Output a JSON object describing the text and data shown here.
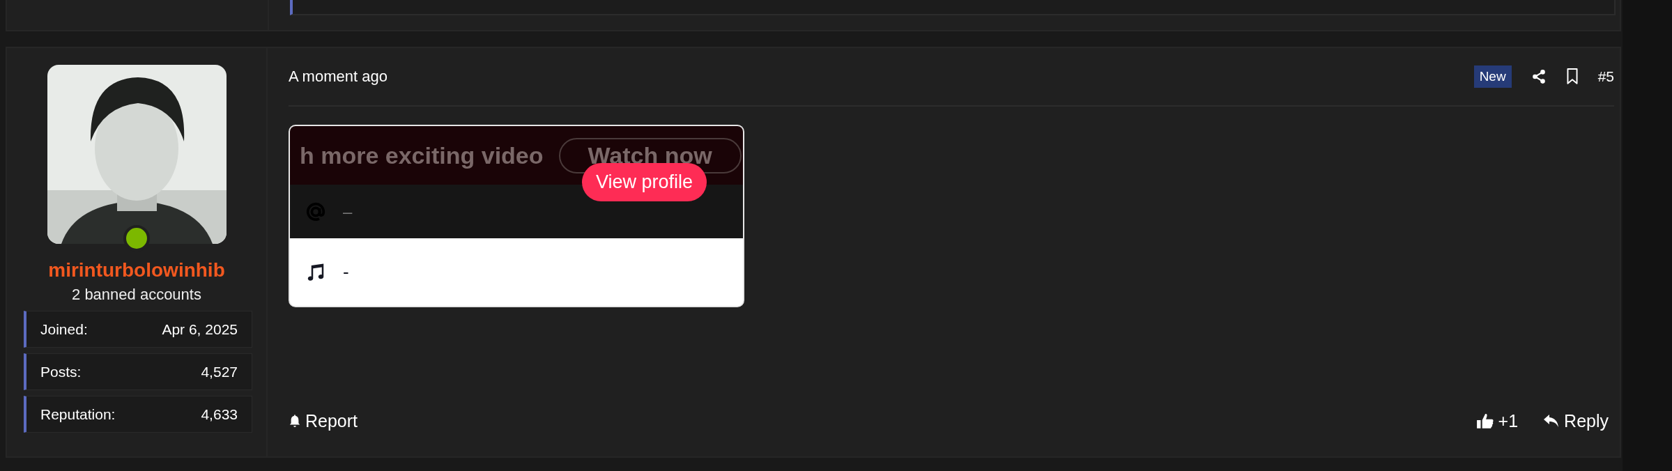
{
  "post": {
    "author": {
      "online": true,
      "username": "mirinturbolowinhib",
      "subtitle": "2 banned accounts",
      "stats": [
        {
          "label": "Joined:",
          "value": "Apr 6, 2025"
        },
        {
          "label": "Posts:",
          "value": "4,527"
        },
        {
          "label": "Reputation:",
          "value": "4,633"
        }
      ]
    },
    "time": "A moment ago",
    "badge": "New",
    "number": "#5",
    "embed": {
      "banner_text": "h more exciting video",
      "watch_label": "Watch now",
      "view_profile": "View profile",
      "handle": "–",
      "sound": "-"
    },
    "actions": {
      "report": "Report",
      "like_count": "+1",
      "reply": "Reply"
    }
  }
}
